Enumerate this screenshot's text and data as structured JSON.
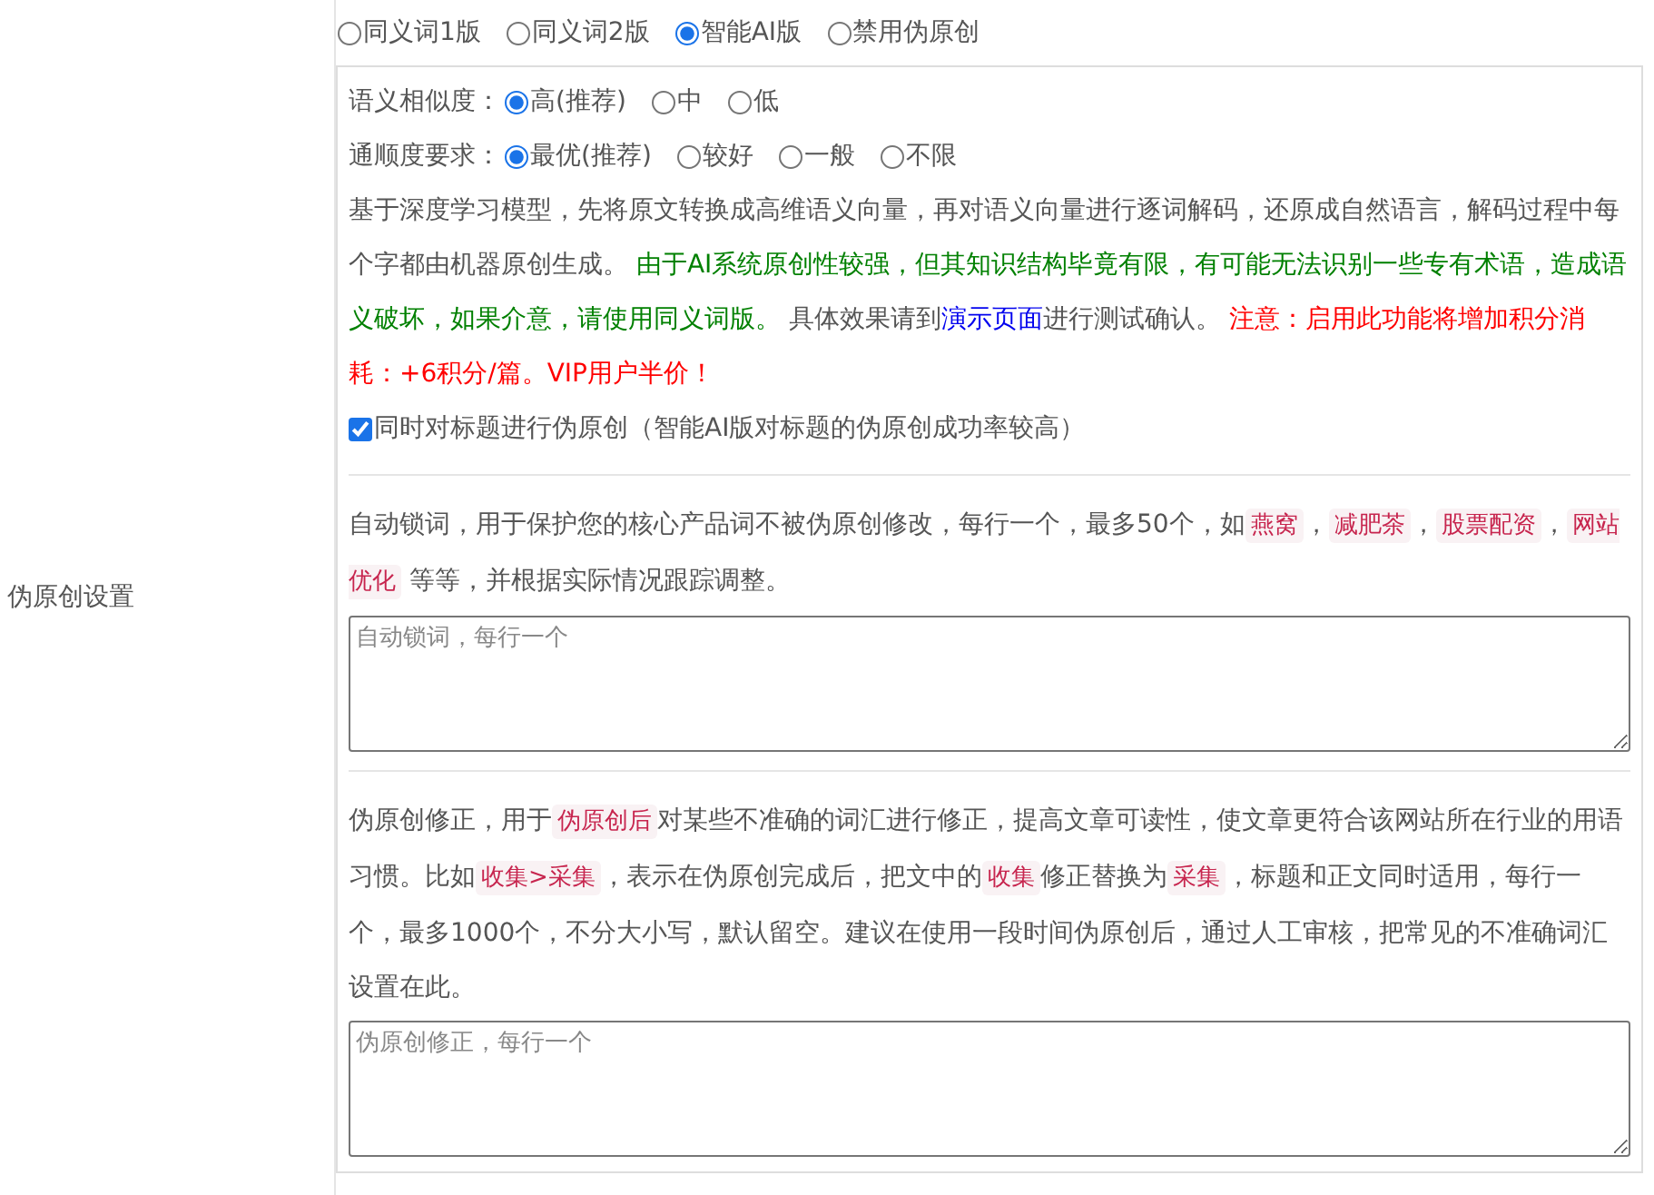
{
  "setting_label": "伪原创设置",
  "modes": [
    {
      "label": "同义词1版",
      "selected": false
    },
    {
      "label": "同义词2版",
      "selected": false
    },
    {
      "label": "智能AI版",
      "selected": true
    },
    {
      "label": "禁用伪原创",
      "selected": false
    }
  ],
  "ai_panel": {
    "similarity": {
      "label": "语义相似度：",
      "options": [
        {
          "label": "高(推荐)",
          "selected": true
        },
        {
          "label": "中",
          "selected": false
        },
        {
          "label": "低",
          "selected": false
        }
      ]
    },
    "fluency": {
      "label": "通顺度要求：",
      "options": [
        {
          "label": "最优(推荐)",
          "selected": true
        },
        {
          "label": "较好",
          "selected": false
        },
        {
          "label": "一般",
          "selected": false
        },
        {
          "label": "不限",
          "selected": false
        }
      ]
    },
    "description": [
      {
        "kind": "plain",
        "text": "基于深度学习模型，先将原文转换成高维语义向量，再对语义向量进行逐词解码，还原成自然语言，解码过程中每个字都由机器原创生成。 "
      },
      {
        "kind": "green",
        "text": "由于AI系统原创性较强，但其知识结构毕竟有限，有可能无法识别一些专有术语，造成语义破坏，如果介意，请使用同义词版。"
      },
      {
        "kind": "plain",
        "text": " 具体效果请到"
      },
      {
        "kind": "link",
        "text": "演示页面"
      },
      {
        "kind": "plain",
        "text": "进行测试确认。 "
      },
      {
        "kind": "red",
        "text": "注意：启用此功能将增加积分消耗：+6积分/篇。VIP用户半价！"
      }
    ],
    "title_option": {
      "label": "同时对标题进行伪原创（智能AI版对标题的伪原创成功率较高）",
      "checked": true
    }
  },
  "lock_words": {
    "description": [
      {
        "kind": "plain",
        "text": "自动锁词，用于保护您的核心产品词不被伪原创修改，每行一个，最多50个，如"
      },
      {
        "kind": "code",
        "text": "燕窝"
      },
      {
        "kind": "plain",
        "text": "，"
      },
      {
        "kind": "code",
        "text": "减肥茶"
      },
      {
        "kind": "plain",
        "text": "，"
      },
      {
        "kind": "code",
        "text": "股票配资"
      },
      {
        "kind": "plain",
        "text": "，"
      },
      {
        "kind": "code",
        "text": "网站优化"
      },
      {
        "kind": "plain",
        "text": " 等等，并根据实际情况跟踪调整。"
      }
    ],
    "placeholder": "自动锁词，每行一个"
  },
  "corrections": {
    "description": [
      {
        "kind": "plain",
        "text": "伪原创修正，用于"
      },
      {
        "kind": "code",
        "text": "伪原创后"
      },
      {
        "kind": "plain",
        "text": "对某些不准确的词汇进行修正，提高文章可读性，使文章更符合该网站所在行业的用语习惯。比如"
      },
      {
        "kind": "code",
        "text": "收集>采集"
      },
      {
        "kind": "plain",
        "text": "，表示在伪原创完成后，把文中的"
      },
      {
        "kind": "code",
        "text": "收集"
      },
      {
        "kind": "plain",
        "text": "修正替换为"
      },
      {
        "kind": "code",
        "text": "采集"
      },
      {
        "kind": "plain",
        "text": "，标题和正文同时适用，每行一个，最多1000个，不分大小写，默认留空。建议在使用一段时间伪原创后，通过人工审核，把常见的不准确词汇设置在此。"
      }
    ],
    "placeholder": "伪原创修正，每行一个"
  }
}
